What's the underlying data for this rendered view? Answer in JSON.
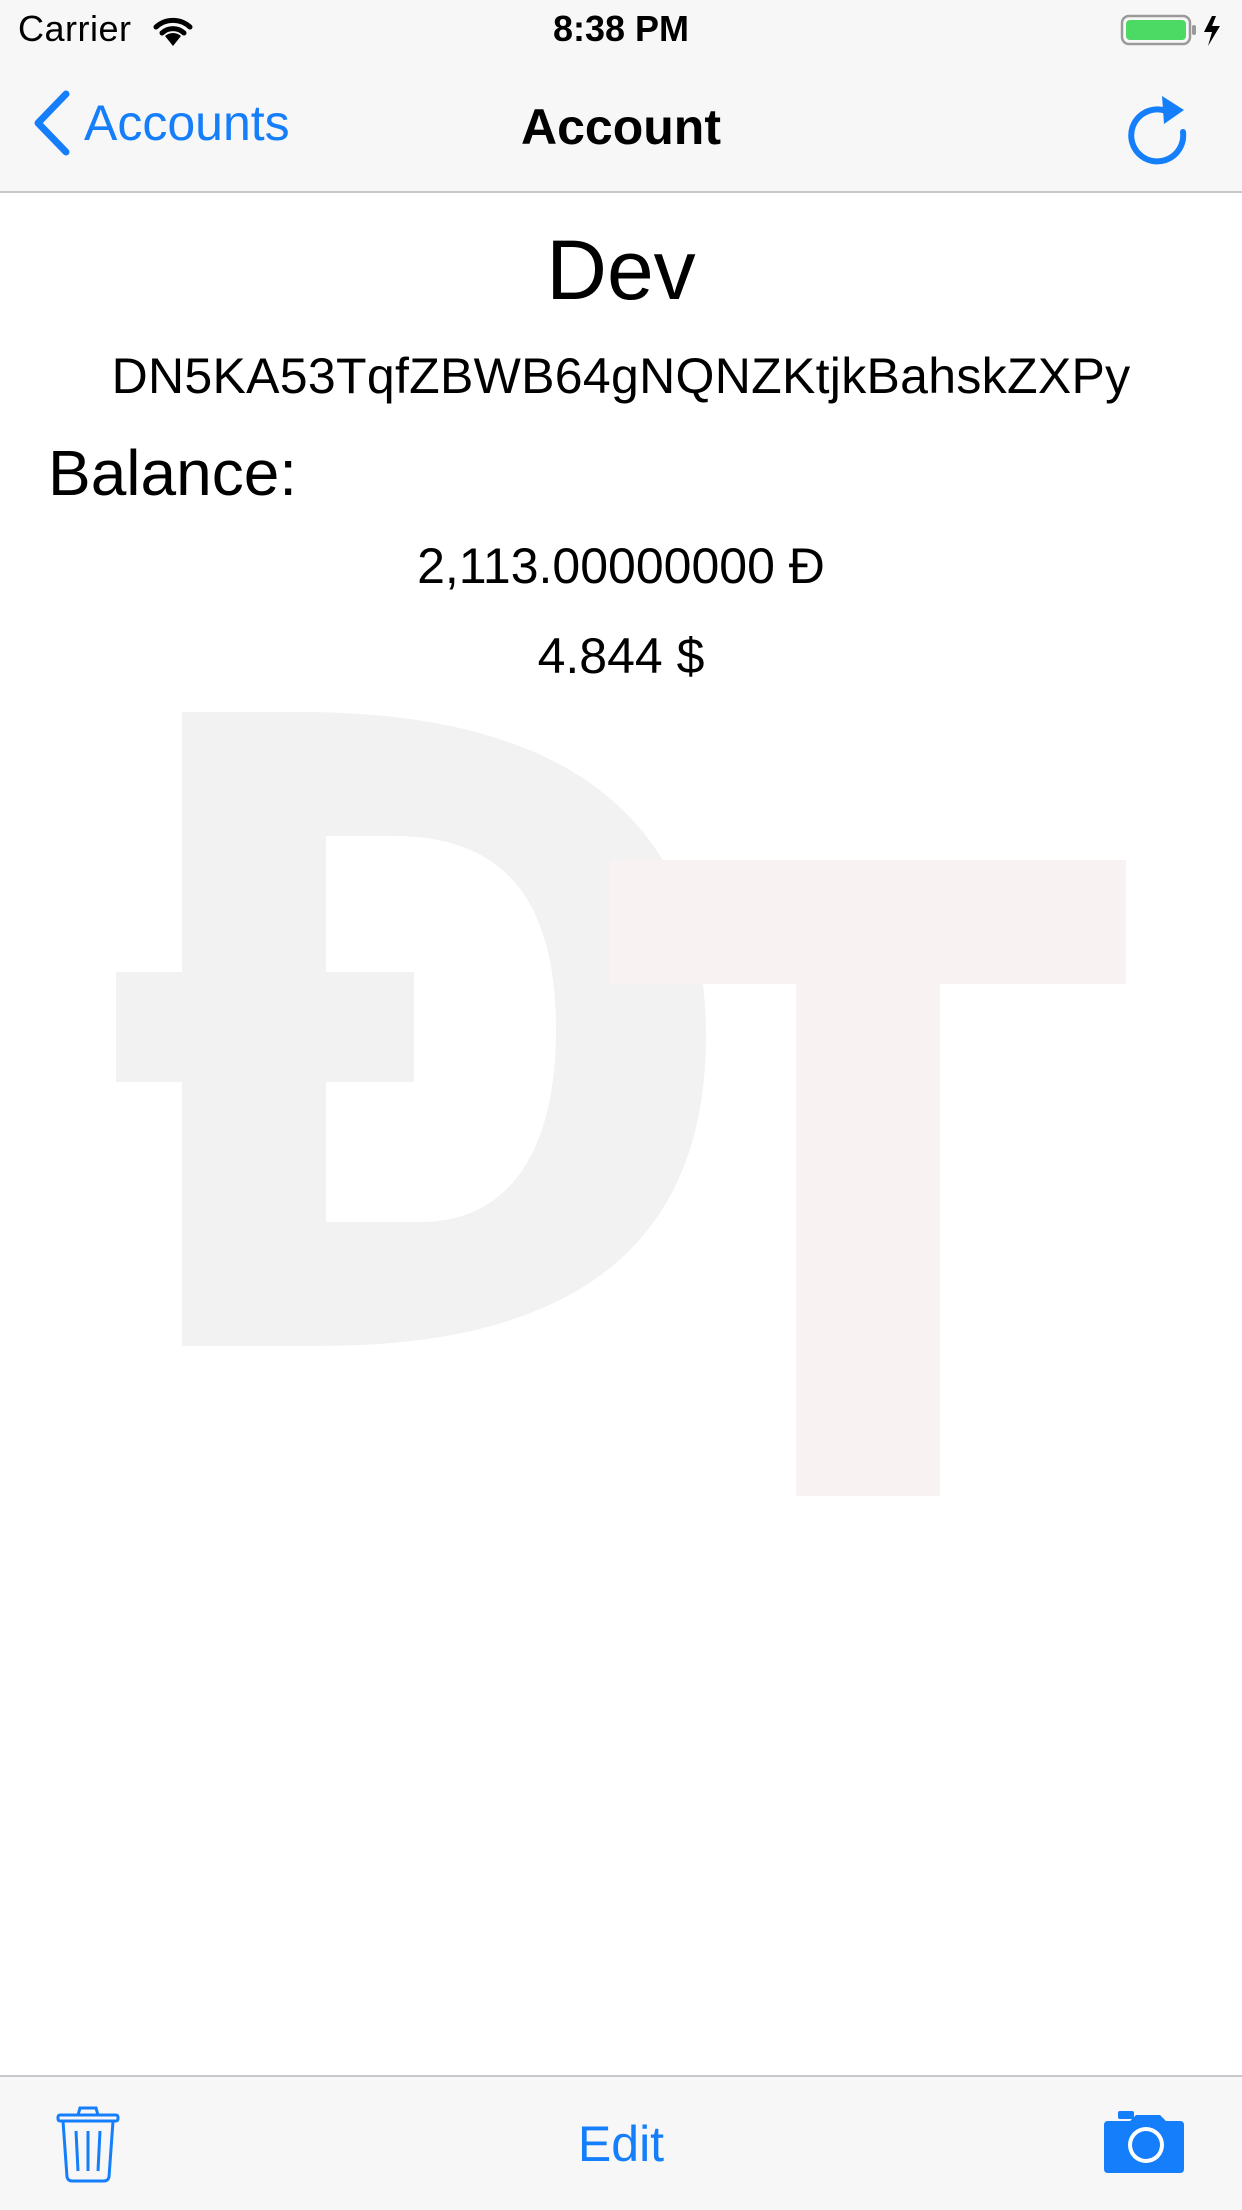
{
  "status_bar": {
    "carrier": "Carrier",
    "time": "8:38 PM",
    "battery_color": "#4cd964"
  },
  "nav": {
    "back_label": "Accounts",
    "title": "Account",
    "accent_color": "#157efb",
    "back_icon": "chevron-left-icon",
    "refresh_icon": "refresh-icon"
  },
  "account": {
    "name": "Dev",
    "address": "DN5KA53TqfZBWB64gNQNZKtjkBahskZXPy",
    "balance_label": "Balance:",
    "balance_doge": "2,113.00000000 Đ",
    "balance_usd": "4.844 $"
  },
  "watermark": {
    "glyph_1": "Đ",
    "glyph_2": "T",
    "color_1": "#f2f2f2",
    "color_2": "#f8f2f2"
  },
  "toolbar": {
    "edit_label": "Edit",
    "trash_icon": "trash-icon",
    "camera_icon": "camera-icon"
  }
}
